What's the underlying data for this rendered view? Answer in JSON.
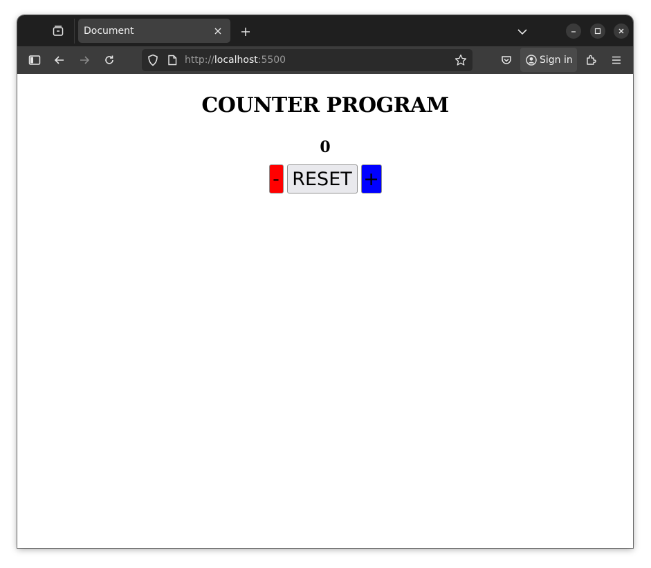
{
  "browser": {
    "tab": {
      "title": "Document"
    },
    "url": {
      "scheme": "http://",
      "host": "localhost",
      "port": ":5500"
    },
    "toolbar": {
      "signin_label": "Sign in"
    }
  },
  "page": {
    "heading": "COUNTER PROGRAM",
    "counter_value": "0",
    "buttons": {
      "decrement_label": "-",
      "reset_label": "RESET",
      "increment_label": "+"
    }
  },
  "colors": {
    "decrement_bg": "#ff0000",
    "increment_bg": "#0000ff",
    "reset_bg": "#e9e9ed"
  },
  "icons": {
    "tabs_menu": "tab-overview-icon",
    "tab_close": "close-icon",
    "new_tab": "plus-icon",
    "tab_list": "chevron-down-icon",
    "sidebar": "sidebar-icon",
    "back": "arrow-left-icon",
    "forward": "arrow-right-icon",
    "reload": "reload-icon",
    "tracking": "shield-icon",
    "page_info": "page-icon",
    "bookmark": "star-icon",
    "pocket": "pocket-icon",
    "account": "account-icon",
    "extensions": "puzzle-icon",
    "menu": "hamburger-menu-icon"
  }
}
